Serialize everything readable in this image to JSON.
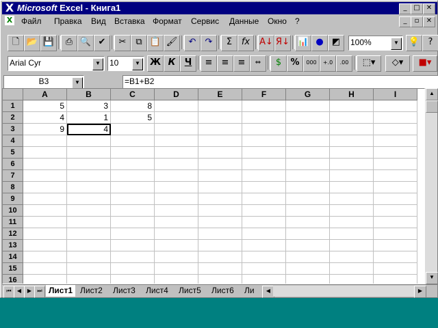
{
  "app": {
    "title_brand": "Microsoft",
    "title_rest": " Excel - Книга1"
  },
  "colors": {
    "titlebar": "#000080",
    "desktop": "#008080",
    "face": "#c0c0c0"
  },
  "menu": [
    "Файл",
    "Правка",
    "Вид",
    "Вставка",
    "Формат",
    "Сервис",
    "Данные",
    "Окно",
    "?"
  ],
  "toolbar": {
    "zoom": "100%"
  },
  "format": {
    "font": "Arial Cyr",
    "size": "10",
    "bold": "Ж",
    "italic": "К",
    "underline": "Ч"
  },
  "formula_bar": {
    "cell_ref": "B3",
    "formula": "=B1+B2"
  },
  "columns": [
    "A",
    "B",
    "C",
    "D",
    "E",
    "F",
    "G",
    "H",
    "I"
  ],
  "rows": [
    "1",
    "2",
    "3",
    "4",
    "5",
    "6",
    "7",
    "8",
    "9",
    "10",
    "11",
    "12",
    "13",
    "14",
    "15",
    "16"
  ],
  "cells": [
    [
      "5",
      "3",
      "8"
    ],
    [
      "4",
      "1",
      "5"
    ],
    [
      "9",
      "4",
      ""
    ]
  ],
  "sheets": [
    "Лист1",
    "Лист2",
    "Лист3",
    "Лист4",
    "Лист5",
    "Лист6",
    "Ли"
  ]
}
